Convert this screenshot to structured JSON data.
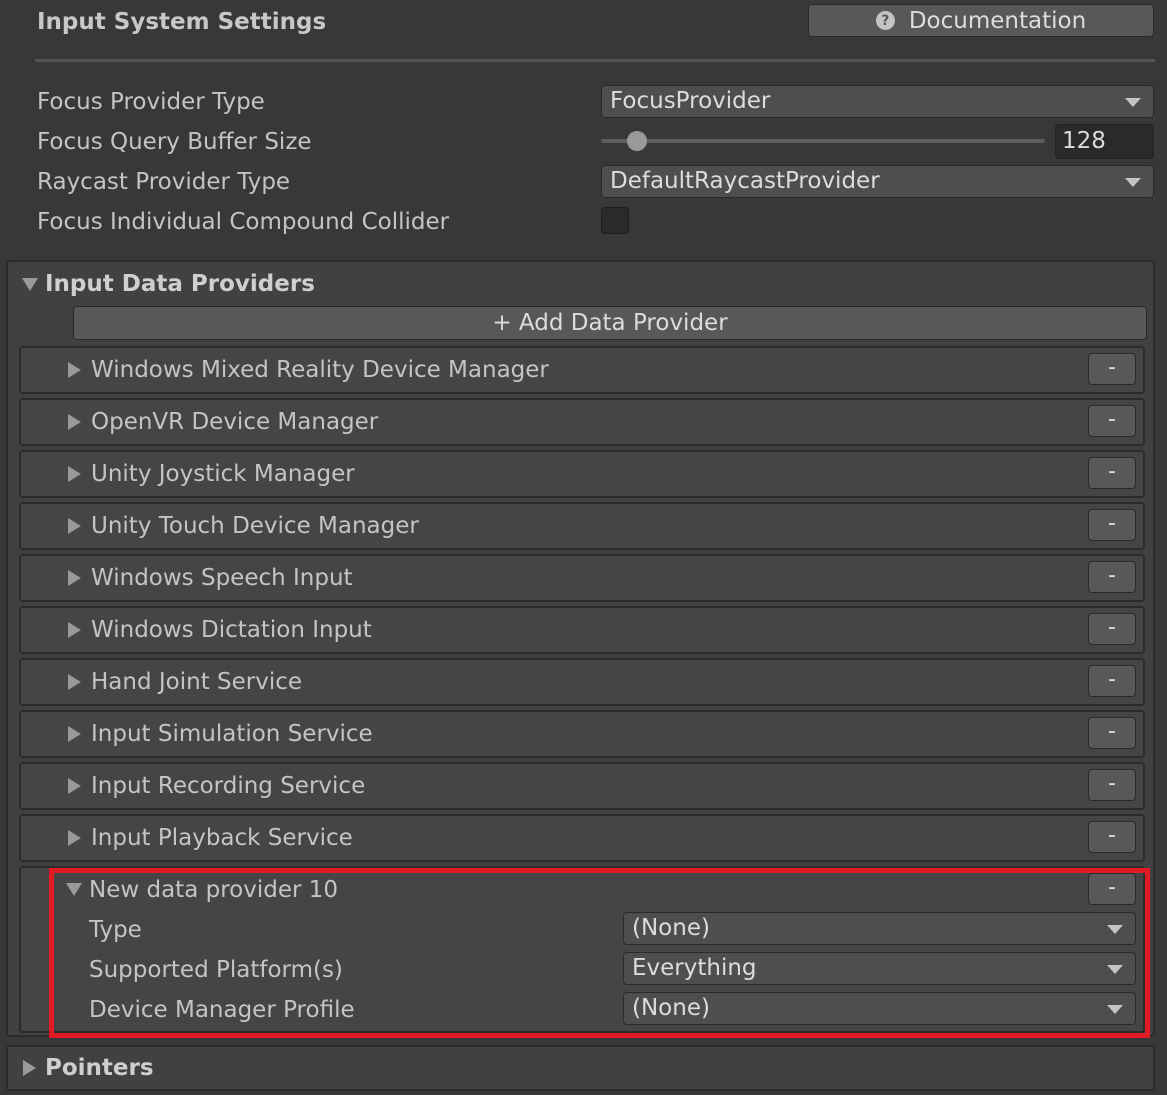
{
  "header": {
    "title": "Input System Settings",
    "doc_label": "Documentation"
  },
  "settings": {
    "focus_provider_type": {
      "label": "Focus Provider Type",
      "value": "FocusProvider"
    },
    "focus_query_buffer_size": {
      "label": "Focus Query Buffer Size",
      "value": "128"
    },
    "raycast_provider_type": {
      "label": "Raycast Provider Type",
      "value": "DefaultRaycastProvider"
    },
    "focus_individual_compound_collider": {
      "label": "Focus Individual Compound Collider",
      "checked": false
    }
  },
  "input_data_providers": {
    "title": "Input Data Providers",
    "add_label": "+ Add Data Provider",
    "remove_label": "-",
    "items": [
      {
        "label": "Windows Mixed Reality Device Manager"
      },
      {
        "label": "OpenVR Device Manager"
      },
      {
        "label": "Unity Joystick Manager"
      },
      {
        "label": "Unity Touch Device Manager"
      },
      {
        "label": "Windows Speech Input"
      },
      {
        "label": "Windows Dictation Input"
      },
      {
        "label": "Hand Joint Service"
      },
      {
        "label": "Input Simulation Service"
      },
      {
        "label": "Input Recording Service"
      },
      {
        "label": "Input Playback Service"
      }
    ],
    "expanded": {
      "label": "New data provider 10",
      "type": {
        "label": "Type",
        "value": "(None)"
      },
      "platforms": {
        "label": "Supported Platform(s)",
        "value": "Everything"
      },
      "profile": {
        "label": "Device Manager Profile",
        "value": "(None)"
      }
    }
  },
  "pointers": {
    "title": "Pointers"
  },
  "colors": {
    "background": "#383838",
    "highlight": "#e01b24"
  },
  "icons": {
    "help": "help-circle-icon",
    "dropdown": "chevron-down-icon",
    "foldout": "triangle-icon"
  }
}
